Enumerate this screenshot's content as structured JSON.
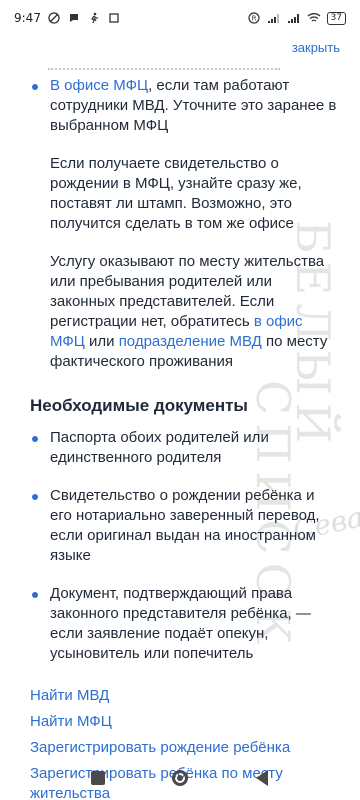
{
  "status_bar": {
    "time": "9:47",
    "left_icons": [
      "do-not-disturb-icon",
      "chat-bubble-icon",
      "walking-person-icon",
      "box-icon"
    ],
    "right_icons": [
      "r-badge-icon",
      "signal-icon",
      "signal-icon",
      "wifi-icon"
    ],
    "battery": "37"
  },
  "header": {
    "close_label": "закрыть"
  },
  "intro_bullet": {
    "prefix": "",
    "link": "В офисе МФЦ",
    "suffix": ", если там работают сотрудники МВД. Уточните это заранее в выбранном МФЦ"
  },
  "note_paragraph": "Если получаете свидетельство о рождении в МФЦ, узнайте сразу же, поставят ли штамп. Возможно, это получится сделать в том же офисе",
  "service_paragraph": {
    "text_before": "Услугу оказывают по месту жительства или пребывания родителей или законных представителей. Если регистрации нет, обратитесь ",
    "link1": "в офис МФЦ",
    "text_middle": " или ",
    "link2": "подразделение МВД",
    "text_after": " по месту фактического проживания"
  },
  "documents": {
    "title": "Необходимые документы",
    "items": [
      "Паспорта обоих родителей или единственного родителя",
      "Свидетельство о рождении ребёнка и его нотариально заверенный перевод, если оригинал выдан на иностранном языке",
      "Документ, подтверждающий права законного представителя ребёнка, — если заявление подаёт опекун, усыновитель или попечитель"
    ]
  },
  "footer_links": [
    "Найти МВД",
    "Найти МФЦ",
    "Зарегистрировать рождение ребёнка",
    "Зарегистрировать ребёнка по месту жительства"
  ],
  "colors": {
    "link": "#2c6fd1",
    "text": "#1f2937",
    "bullet": "#2c6fd1"
  }
}
